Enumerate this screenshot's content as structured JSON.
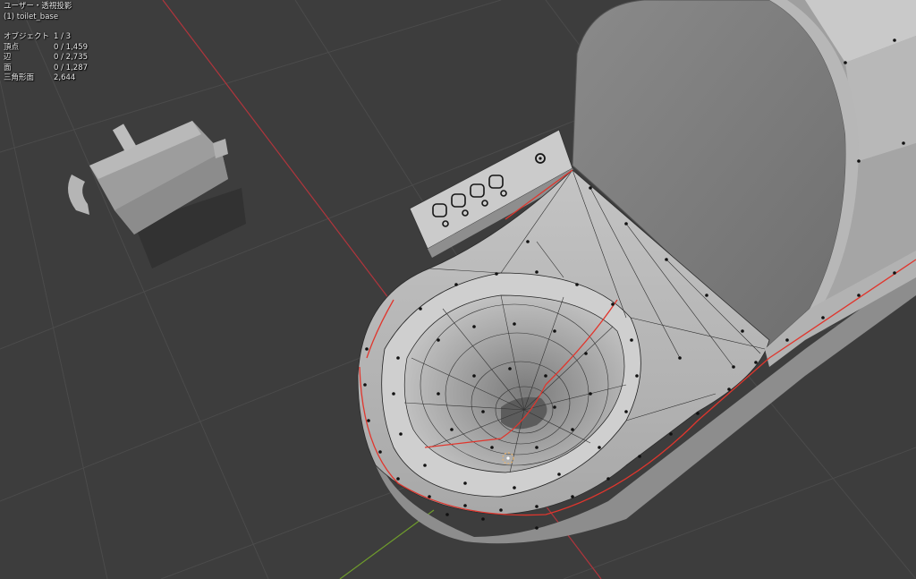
{
  "viewport": {
    "view_name": "ユーザー・透視投影",
    "active_object": "(1) toilet_base",
    "stats": [
      {
        "label": "オブジェクト",
        "value": "1 / 3"
      },
      {
        "label": "頂点",
        "value": "0 / 1,459"
      },
      {
        "label": "辺",
        "value": "0 / 2,735"
      },
      {
        "label": "面",
        "value": "0 / 1,287"
      },
      {
        "label": "三角形面",
        "value": "2,644"
      }
    ]
  },
  "colors": {
    "background": "#3d3d3d",
    "grid": "#4a4a4a",
    "x_axis": "#b0353c",
    "y_axis": "#6f9c2c",
    "mesh": "#bdbdbd",
    "mesh_dark": "#8f8f8f",
    "seam": "#e0362d",
    "vertex": "#111111"
  },
  "icons": [
    "3d-cursor-icon",
    "power-button-icon"
  ]
}
